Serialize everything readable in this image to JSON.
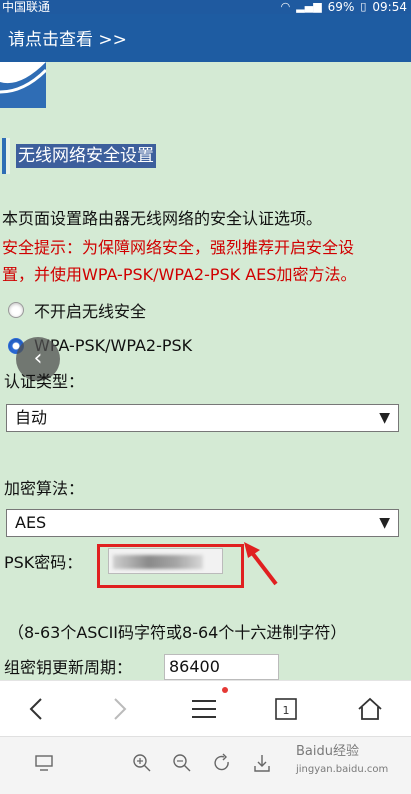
{
  "status_bar": {
    "carrier": "中国联通",
    "battery": "69%",
    "time": "09:54"
  },
  "banner": {
    "link_text": "请点击查看 >>"
  },
  "section": {
    "title": "无线网络安全设置"
  },
  "description": "本页面设置路由器无线网络的安全认证选项。",
  "warning_line1": "安全提示：为保障网络安全，强烈推荐开启安全设",
  "warning_line2": "置，并使用WPA-PSK/WPA2-PSK AES加密方法。",
  "security_options": [
    {
      "label": "不开启无线安全",
      "checked": false
    },
    {
      "label": "WPA-PSK/WPA2-PSK",
      "checked": true
    }
  ],
  "auth_type": {
    "label": "认证类型：",
    "value": "自动"
  },
  "encryption": {
    "label": "加密算法：",
    "value": "AES"
  },
  "psk": {
    "label": "PSK密码："
  },
  "hint": "（8-63个ASCII码字符或8-64个十六进制字符）",
  "group_key": {
    "label": "组密钥更新周期：",
    "value": "86400"
  },
  "nav": {
    "tab_count": "1"
  },
  "watermark": {
    "text": "Baidu经验",
    "url": "jingyan.baidu.com"
  },
  "colors": {
    "page_bg": "#d4ead4",
    "banner_bg": "#1e5ca2",
    "warning": "#d00000",
    "highlight": "#e02020"
  }
}
